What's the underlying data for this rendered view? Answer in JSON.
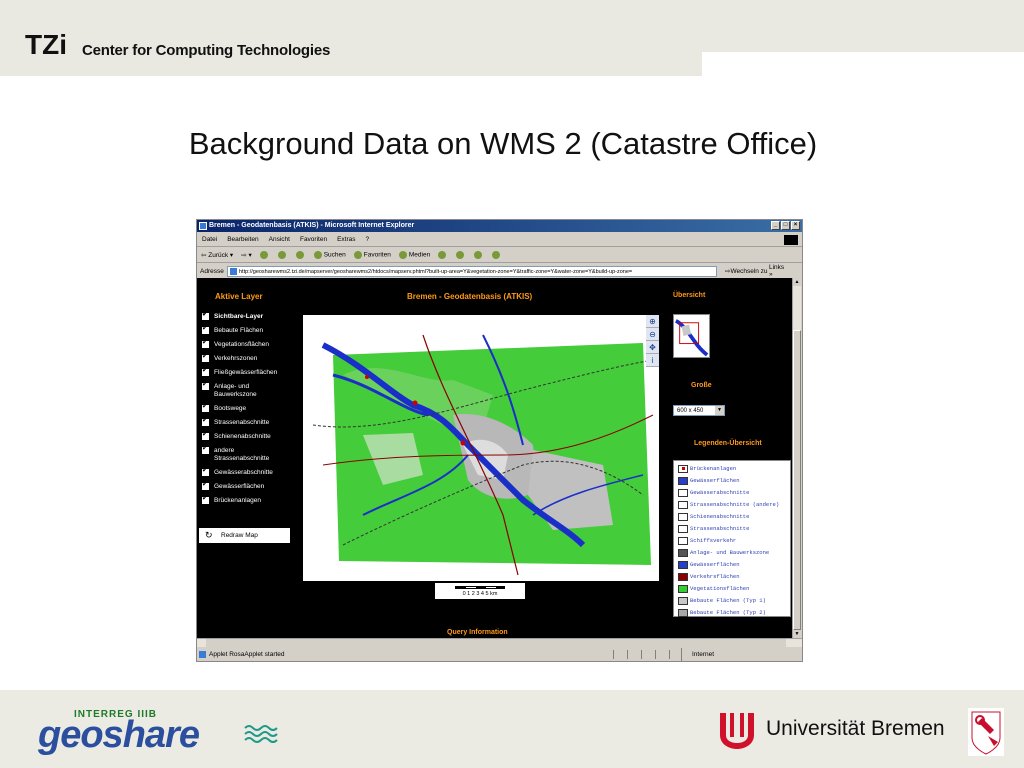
{
  "header": {
    "logo": "TZi",
    "title": "Center for Computing Technologies"
  },
  "slide": {
    "title": "Background Data on WMS 2 (Catastre Office)"
  },
  "footer": {
    "small_logo": "INTERREG IIIB",
    "logo": "geoshare",
    "university": "Universität Bremen"
  },
  "browser": {
    "window_title": "Bremen - Geodatenbasis (ATKIS) - Microsoft Internet Explorer",
    "window_buttons": [
      "_",
      "□",
      "×"
    ],
    "menu": [
      "Datei",
      "Bearbeiten",
      "Ansicht",
      "Favoriten",
      "Extras",
      "?"
    ],
    "toolbar": {
      "back": "⇦ Zurück ▾",
      "forward": "⇨ ▾",
      "search": "Suchen",
      "favorites": "Favoriten",
      "media": "Medien"
    },
    "address": {
      "label": "Adresse",
      "url": "http://geosharewms2.tzi.de/mapserver/geosharewms2/htdocs/mapserv.phtml?built-up-area=Y&vegetation-zone=Y&traffic-zone=Y&water-zone=Y&build-up-zone=",
      "go": "⇨Wechseln zu",
      "links": "Links »"
    },
    "status": {
      "text": "Applet RosaApplet started",
      "zone": "Internet"
    }
  },
  "page": {
    "layer_header": "Aktive Layer",
    "map_title": "Bremen - Geodatenbasis (ATKIS)",
    "overview_label": "Übersicht",
    "size_label": "Große",
    "size_value": "600 x 450",
    "legend_label": "Legenden-Übersicht",
    "query_label": "Query Information",
    "redraw_label": "Redraw Map",
    "scale_label": "0  1  2  3  4  5 km",
    "layers": [
      "Sichtbare-Layer",
      "Bebaute Flächen",
      "Vegetationsflächen",
      "Verkehrszonen",
      "Fließgewässerflächen",
      "Anlage- und Bauwerkszone",
      "Bootswege",
      "Strassenabschnitte",
      "Schienenabschnitte",
      "andere Strassenabschnitte",
      "Gewässerabschnitte",
      "Gewässerflächen",
      "Brückenanlagen"
    ],
    "map_tools": [
      "zoom-in",
      "zoom-out",
      "pan",
      "info"
    ],
    "legend": [
      {
        "label": "Brückenanlagen",
        "color": "#ffffff"
      },
      {
        "label": "Gewässerflächen",
        "color": "#2a3fc8"
      },
      {
        "label": "Gewässerabschnitte",
        "color": "#ffffff"
      },
      {
        "label": "Strassenabschnitte (andere)",
        "color": "#ffffff"
      },
      {
        "label": "Schienenabschnitte",
        "color": "#ffffff"
      },
      {
        "label": "Strassenabschnitte",
        "color": "#ffffff"
      },
      {
        "label": "Schiffsverkehr",
        "color": "#ffffff"
      },
      {
        "label": "Anlage- und Bauwerkszone",
        "color": "#555555"
      },
      {
        "label": "Gewässerflächen",
        "color": "#2a3fc8"
      },
      {
        "label": "Verkehrsflächen",
        "color": "#8b0000"
      },
      {
        "label": "Vegetationsflächen",
        "color": "#33cc33"
      },
      {
        "label": "Bebaute Flächen (Typ 1)",
        "color": "#c8c8c8"
      },
      {
        "label": "Bebaute Flächen (Typ 2)",
        "color": "#a8a8a8"
      }
    ]
  },
  "colors": {
    "accent_orange": "#ff9a1a",
    "vegetation": "#33cc33",
    "water": "#2a3fc8"
  }
}
